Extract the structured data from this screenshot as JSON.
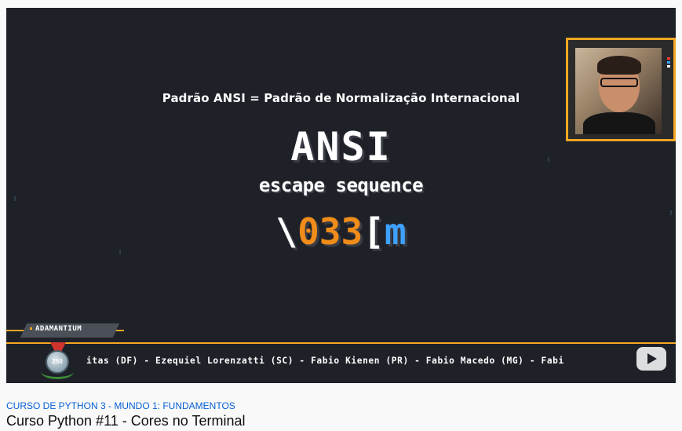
{
  "video": {
    "subtitle": "Padrão ANSI = Padrão de Normalização Internacional",
    "big_title": "ANSI",
    "escape_line": "escape sequence",
    "code_parts": {
      "slash": "\\",
      "digits": "033",
      "bracket": "[",
      "m": "m"
    },
    "tag_label": "ADAMANTIUM",
    "badge_number": "250",
    "ticker": "itas (DF) - Ezequiel Lorenzatti (SC) - Fabio Kienen (PR) - Fabio Macedo (MG) - Fabi"
  },
  "page": {
    "playlist_link": "CURSO DE PYTHON 3 - MUNDO 1: FUNDAMENTOS",
    "title": "Curso Python #11 - Cores no Terminal"
  },
  "colors": {
    "background": "#1e2128",
    "accent_orange": "#f08c1a",
    "accent_blue": "#3ea1ff",
    "frame": "#f5a623",
    "link": "#065fd4"
  },
  "icons": {
    "watermark": "youtube-play-icon",
    "badge": "medal-icon"
  }
}
